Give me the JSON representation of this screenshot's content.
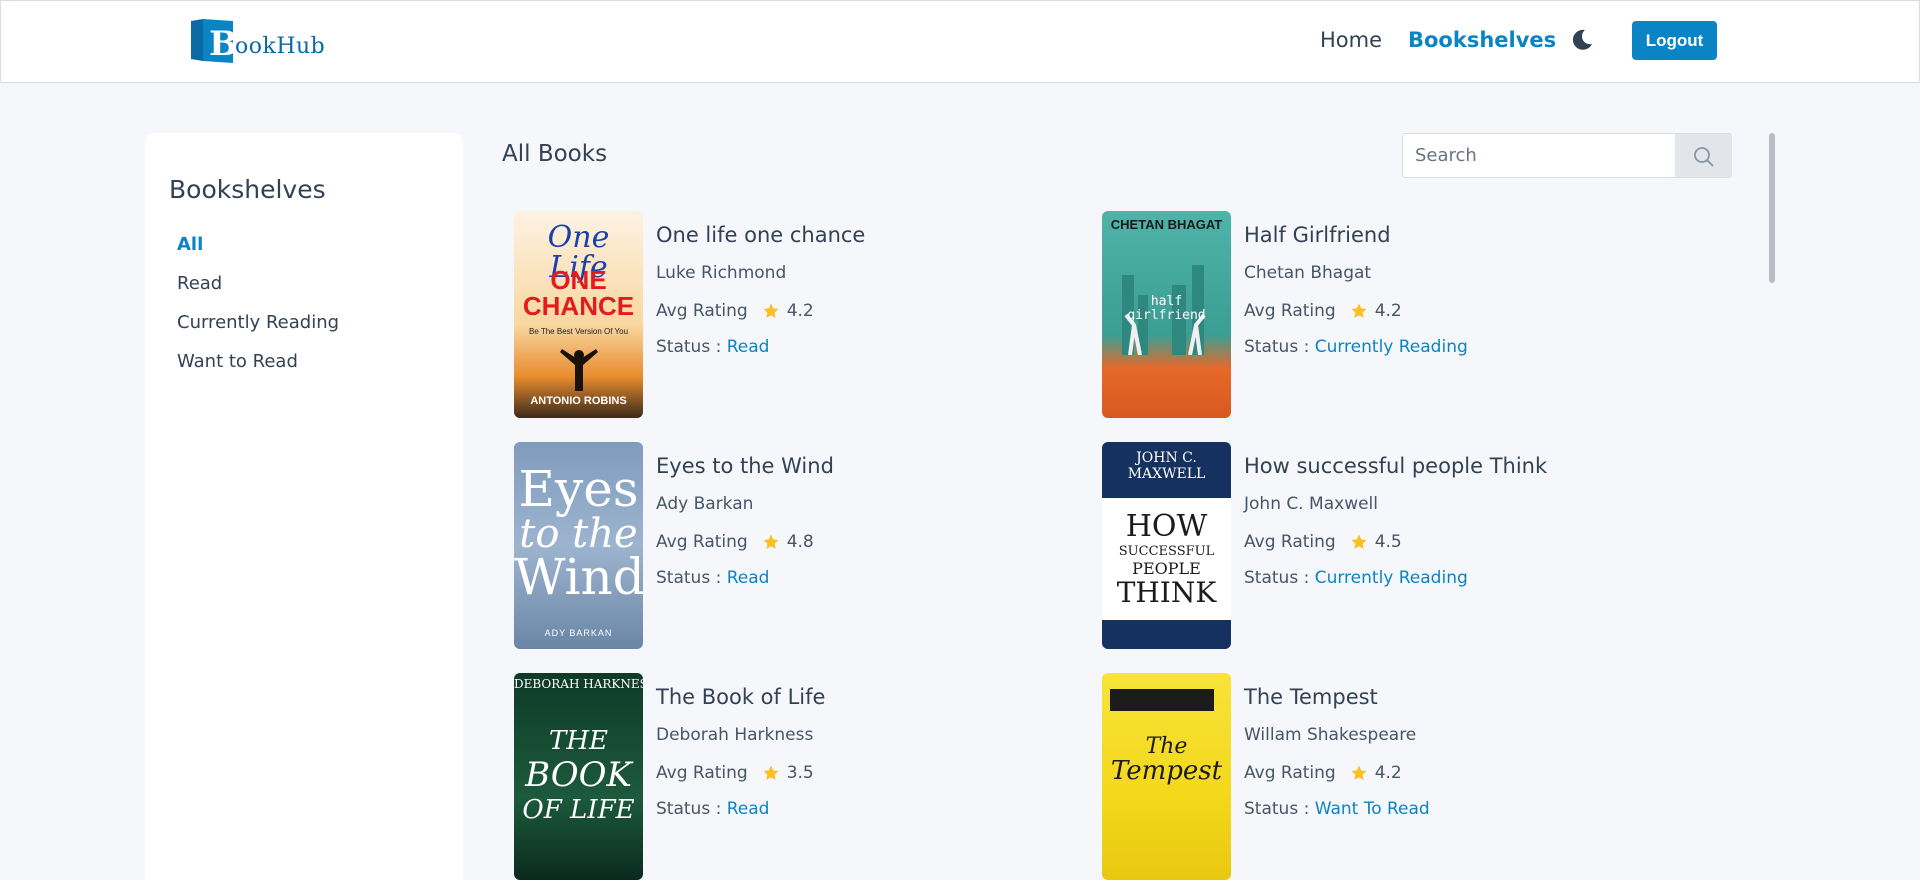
{
  "nav": {
    "logo_text": "ookHub",
    "logo_letter": "B",
    "home": "Home",
    "bookshelves": "Bookshelves",
    "logout": "Logout",
    "accent": "#0b84c6"
  },
  "sidebar": {
    "title": "Bookshelves",
    "items": [
      {
        "label": "All",
        "active": true
      },
      {
        "label": "Read",
        "active": false
      },
      {
        "label": "Currently Reading",
        "active": false
      },
      {
        "label": "Want to Read",
        "active": false
      }
    ]
  },
  "main": {
    "title": "All Books",
    "search_placeholder": "Search"
  },
  "books": [
    {
      "title": "One life one chance",
      "author": "Luke Richmond",
      "rating_label": "Avg Rating",
      "rating": "4.2",
      "status_label": "Status : ",
      "status": "Read",
      "cover": {
        "line1": "One Life",
        "line2": "ONE",
        "line3": "CHANCE",
        "tag": "Be The Best Version Of You",
        "author": "ANTONIO ROBINS"
      }
    },
    {
      "title": "Half Girlfriend",
      "author": "Chetan Bhagat",
      "rating_label": "Avg Rating",
      "rating": "4.2",
      "status_label": "Status : ",
      "status": "Currently Reading",
      "cover": {
        "author": "CHETAN BHAGAT",
        "line1": "half",
        "line2": "girlfriend"
      }
    },
    {
      "title": "Eyes to the Wind",
      "author": "Ady Barkan",
      "rating_label": "Avg Rating",
      "rating": "4.8",
      "status_label": "Status : ",
      "status": "Read",
      "cover": {
        "line1": "Eyes",
        "line2": "to the",
        "line3": "Wind",
        "author": "ADY BARKAN"
      }
    },
    {
      "title": "How successful people Think",
      "author": "John C. Maxwell",
      "rating_label": "Avg Rating",
      "rating": "4.5",
      "status_label": "Status : ",
      "status": "Currently Reading",
      "cover": {
        "author": "JOHN C. MAXWELL",
        "line1": "HOW",
        "line2": "SUCCESSFUL",
        "line3": "PEOPLE",
        "line4": "THINK"
      }
    },
    {
      "title": "The Book of Life",
      "author": "Deborah Harkness",
      "rating_label": "Avg Rating",
      "rating": "3.5",
      "status_label": "Status : ",
      "status": "Read",
      "cover": {
        "author": "DEBORAH HARKNESS",
        "line1": "THE",
        "line2": "BOOK",
        "line3": "OF LIFE"
      }
    },
    {
      "title": "The Tempest",
      "author": "Willam Shakespeare",
      "rating_label": "Avg Rating",
      "rating": "4.2",
      "status_label": "Status : ",
      "status": "Want To Read",
      "cover": {
        "line1": "The",
        "line2": "Tempest"
      }
    }
  ]
}
